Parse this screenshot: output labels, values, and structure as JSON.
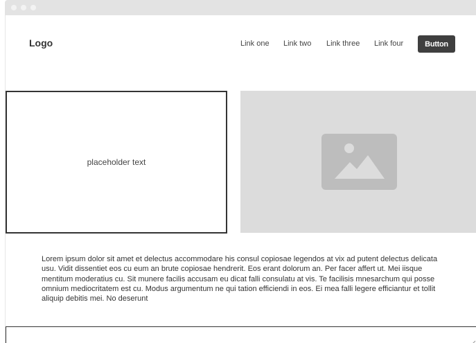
{
  "header": {
    "logo": "Logo",
    "nav_links": [
      "Link one",
      "Link two",
      "Link three",
      "Link four"
    ],
    "button_label": "Button"
  },
  "hero": {
    "text_box": "placeholder text",
    "image_icon": "image-icon"
  },
  "body": {
    "paragraph": "Lorem ipsum dolor sit amet et delectus accommodare his consul copiosae legendos at vix ad putent delectus delicata usu. Vidit dissentiet eos cu eum an brute copiosae hendrerit. Eos erant dolorum an. Per facer affert ut. Mei iisque mentitum moderatius cu. Sit munere facilis accusam eu dicat falli consulatu at vis. Te facilisis mnesarchum qui posse omnium mediocritatem est cu. Modus argumentum ne qui tation efficiendi in eos. Ei mea falli legere efficiantur et tollit aliquip debitis mei. No deserunt"
  },
  "colors": {
    "chrome": "#e3e3e3",
    "button": "#3f3f3f",
    "placeholder": "#dcdcdc",
    "icon": "#bdbdbd"
  }
}
